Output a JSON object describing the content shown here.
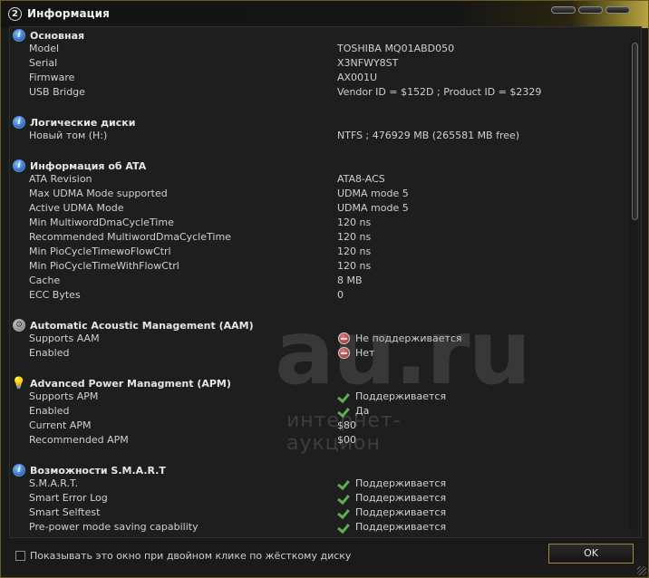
{
  "window": {
    "badge": "2",
    "title": "Информация"
  },
  "sections": {
    "basic": {
      "title": "Основная",
      "rows": [
        {
          "key": "Model",
          "value": "TOSHIBA MQ01ABD050"
        },
        {
          "key": "Serial",
          "value": "X3NFWY8ST"
        },
        {
          "key": "Firmware",
          "value": "AX001U"
        },
        {
          "key": "USB Bridge",
          "value": "Vendor ID = $152D ; Product ID = $2329"
        }
      ]
    },
    "logical": {
      "title": "Логические диски",
      "rows": [
        {
          "key": "Новый том (H:)",
          "value": "NTFS ; 476929 MB (265581 MB free)"
        }
      ]
    },
    "ata": {
      "title": "Информация об ATA",
      "rows": [
        {
          "key": "ATA Revision",
          "value": "ATA8-ACS"
        },
        {
          "key": "Max UDMA Mode supported",
          "value": "UDMA mode 5"
        },
        {
          "key": "Active UDMA Mode",
          "value": "UDMA mode 5"
        },
        {
          "key": "Min MultiwordDmaCycleTime",
          "value": "120 ns"
        },
        {
          "key": "Recommended MultiwordDmaCycleTime",
          "value": "120 ns"
        },
        {
          "key": "Min PioCycleTimewoFlowCtrl",
          "value": "120 ns"
        },
        {
          "key": "Min PioCycleTimeWithFlowCtrl",
          "value": "120 ns"
        },
        {
          "key": "Cache",
          "value": "8 MB"
        },
        {
          "key": "ECC Bytes",
          "value": "0"
        }
      ]
    },
    "aam": {
      "title": "Automatic Acoustic Management (AAM)",
      "rows": [
        {
          "key": "Supports AAM",
          "value": "Не поддерживается",
          "icon": "no-entry-icon"
        },
        {
          "key": "Enabled",
          "value": "Нет",
          "icon": "no-entry-icon"
        }
      ]
    },
    "apm": {
      "title": "Advanced Power Managment (APM)",
      "rows": [
        {
          "key": "Supports APM",
          "value": "Поддерживается",
          "icon": "check-icon"
        },
        {
          "key": "Enabled",
          "value": "Да",
          "icon": "check-icon"
        },
        {
          "key": "Current APM",
          "value": "$80"
        },
        {
          "key": "Recommended APM",
          "value": "$00"
        }
      ]
    },
    "smart": {
      "title": "Возможности S.M.A.R.T",
      "rows": [
        {
          "key": "S.M.A.R.T.",
          "value": "Поддерживается",
          "icon": "check-icon"
        },
        {
          "key": "Smart Error Log",
          "value": "Поддерживается",
          "icon": "check-icon"
        },
        {
          "key": "Smart Selftest",
          "value": "Поддерживается",
          "icon": "check-icon"
        },
        {
          "key": "Pre-power mode saving capability",
          "value": "Поддерживается",
          "icon": "check-icon"
        }
      ]
    }
  },
  "watermark": {
    "brand": "au.ru",
    "tagline": "интернет-аукцион"
  },
  "footer": {
    "checkbox_label": "Показывать это окно при двойном клике по жёсткому диску",
    "checkbox_checked": false,
    "ok_label": "OK"
  },
  "colors": {
    "accent": "#b9a545",
    "check": "#5ab04a",
    "no_entry": "#b51e1e",
    "info_icon": "#2a6bc8"
  }
}
